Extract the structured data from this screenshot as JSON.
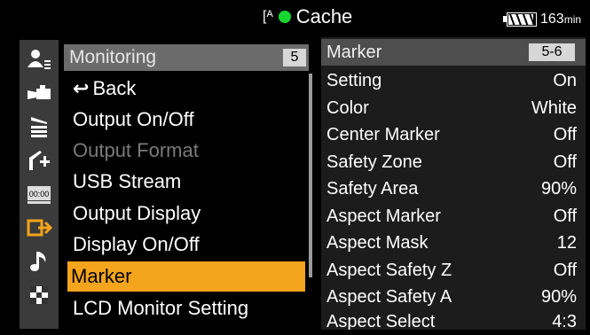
{
  "status_bar": {
    "media_icon": "[ᴬ",
    "record_dot_color": "#16d62e",
    "cache_label": "Cache",
    "battery_icon": "battery-icon",
    "runtime_value": "163",
    "runtime_unit": "min"
  },
  "sidebar": {
    "icons": [
      "user-icon",
      "camera-icon",
      "clapper-icon",
      "tc-icon",
      "timecode-icon",
      "output-icon",
      "audio-icon",
      "grid-icon"
    ],
    "active_index": 5
  },
  "menu": {
    "title": "Monitoring",
    "page": "5",
    "items": [
      {
        "label": "Back",
        "state": "normal"
      },
      {
        "label": "Output On/Off",
        "state": "normal"
      },
      {
        "label": "Output Format",
        "state": "disabled"
      },
      {
        "label": "USB Stream",
        "state": "normal"
      },
      {
        "label": "Output Display",
        "state": "normal"
      },
      {
        "label": "Display On/Off",
        "state": "normal"
      },
      {
        "label": "Marker",
        "state": "selected"
      },
      {
        "label": "LCD Monitor Setting",
        "state": "normal"
      }
    ],
    "selected_color": "#f5a51d"
  },
  "panel": {
    "title": "Marker",
    "page": "5-6",
    "rows": [
      {
        "label": "Setting",
        "value": "On"
      },
      {
        "label": "Color",
        "value": "White"
      },
      {
        "label": "Center Marker",
        "value": "Off"
      },
      {
        "label": "Safety Zone",
        "value": "Off"
      },
      {
        "label": "Safety Area",
        "value": "90%"
      },
      {
        "label": "Aspect Marker",
        "value": "Off"
      },
      {
        "label": "Aspect Mask",
        "value": "12"
      },
      {
        "label": "Aspect Safety Z",
        "value": "Off"
      },
      {
        "label": "Aspect Safety A",
        "value": "90%"
      },
      {
        "label": "Aspect Select",
        "value": "4:3"
      }
    ]
  }
}
